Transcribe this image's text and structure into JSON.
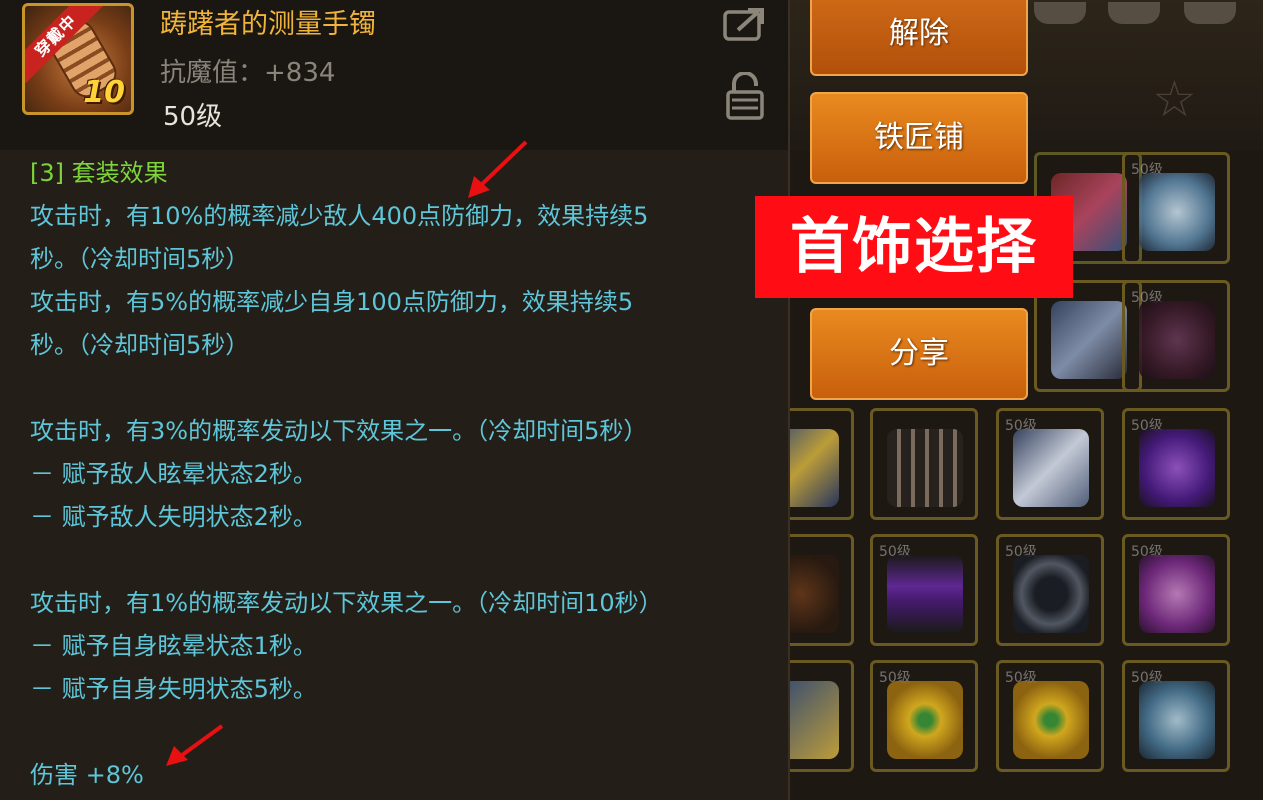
{
  "item": {
    "name": "踌躇者的测量手镯",
    "stat": "抗魔值：+834",
    "level": "50级",
    "equipped_badge": "穿戴中",
    "upgrade_level": "10"
  },
  "set_effect": {
    "title": "[3] 套装效果",
    "lines": [
      "攻击时，有10%的概率减少敌人400点防御力，效果持续5",
      "秒。（冷却时间5秒）",
      "攻击时，有5%的概率减少自身100点防御力，效果持续5",
      "秒。（冷却时间5秒）",
      "",
      "攻击时，有3%的概率发动以下效果之一。（冷却时间5秒）",
      "－ 赋予敌人眩晕状态2秒。",
      "－ 赋予敌人失明状态2秒。",
      "",
      "攻击时，有1%的概率发动以下效果之一。（冷却时间10秒）",
      "－ 赋予自身眩晕状态1秒。",
      "－ 赋予自身失明状态5秒。"
    ],
    "footer": "伤害 +8%"
  },
  "buttons": {
    "remove": "解除",
    "blacksmith": "铁匠铺",
    "share": "分享"
  },
  "overlay_label": "首饰选择",
  "inventory": {
    "slot_level_label": "50级"
  },
  "colors": {
    "item_name": "#f0b43a",
    "set_title": "#7ed43a",
    "effect_text": "#5ec6d8",
    "button": "#e07a18",
    "overlay": "#ff0c14",
    "annotation_arrow": "#e81010"
  },
  "icons": [
    "share-icon",
    "lock-icon",
    "star-icon",
    "arrow-annotation-icon"
  ]
}
